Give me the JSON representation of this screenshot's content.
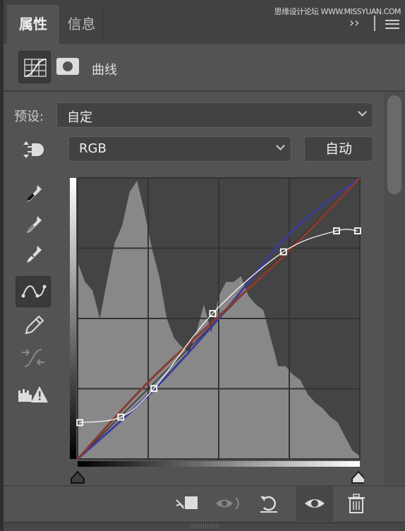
{
  "tabs": [
    {
      "label": "属性",
      "active": true
    },
    {
      "label": "信息",
      "active": false
    }
  ],
  "watermark": "思缘设计论坛 WWW.MISSYUAN.COM",
  "header": {
    "title": "曲线",
    "icons": [
      "curves-adjustment-icon",
      "layer-mask-icon"
    ]
  },
  "preset": {
    "label": "预设:",
    "value": "自定"
  },
  "channel": {
    "value": "RGB"
  },
  "auto_button": "自动",
  "tools": [
    "on-image-adjust-icon",
    "black-point-eyedropper-icon",
    "gray-point-eyedropper-icon",
    "white-point-eyedropper-icon",
    "curve-points-icon",
    "pencil-icon",
    "smooth-curve-icon",
    "clipping-warning-icon"
  ],
  "selected_tool": "curve-points-icon",
  "bottom_icons": [
    "clip-to-layer-icon",
    "view-previous-state-icon",
    "reset-icon",
    "visibility-eye-icon",
    "delete-icon"
  ],
  "chart_data": {
    "type": "line",
    "xlim": [
      0,
      255
    ],
    "ylim": [
      0,
      255
    ],
    "grid": "4x4",
    "rgb_curve_points": [
      [
        2,
        33
      ],
      [
        39,
        38
      ],
      [
        69,
        64
      ],
      [
        122,
        132
      ],
      [
        186,
        188
      ],
      [
        234,
        207
      ],
      [
        253,
        207
      ]
    ],
    "red_curve_points": [
      [
        0,
        0
      ],
      [
        64,
        70
      ],
      [
        128,
        130
      ],
      [
        192,
        190
      ],
      [
        255,
        255
      ]
    ],
    "blue_curve_points": [
      [
        0,
        0
      ],
      [
        64,
        58
      ],
      [
        128,
        128
      ],
      [
        192,
        205
      ],
      [
        255,
        255
      ]
    ],
    "histogram": [
      0.7,
      0.63,
      0.6,
      0.5,
      0.64,
      0.77,
      0.83,
      0.95,
      0.99,
      0.88,
      0.75,
      0.65,
      0.5,
      0.43,
      0.4,
      0.38,
      0.45,
      0.55,
      0.45,
      0.58,
      0.63,
      0.63,
      0.65,
      0.58,
      0.55,
      0.53,
      0.43,
      0.33,
      0.33,
      0.3,
      0.28,
      0.23,
      0.2,
      0.18,
      0.15,
      0.13,
      0.08,
      0.03,
      0.01
    ],
    "colors": {
      "rgb": "#ffffff",
      "red": "#8a3a30",
      "blue": "#3c3c9a",
      "histogram": "#888888",
      "background": "#444444"
    }
  }
}
